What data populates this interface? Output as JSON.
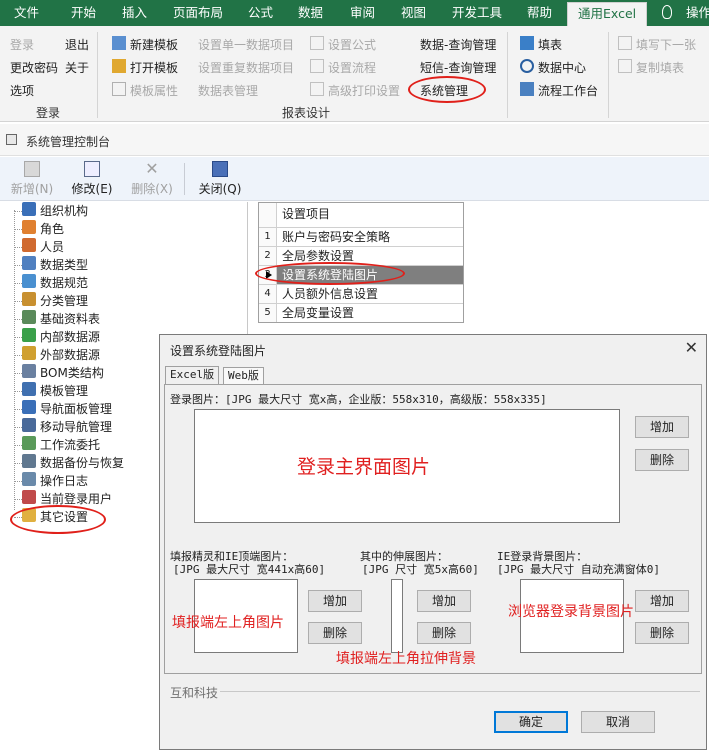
{
  "ribbon": {
    "tabs": [
      "文件",
      "开始",
      "插入",
      "页面布局",
      "公式",
      "数据",
      "审阅",
      "视图",
      "开发工具",
      "帮助",
      "通用Excel",
      "操作"
    ],
    "groups": {
      "login": {
        "label": "登录",
        "items": [
          "登录",
          "退出",
          "更改密码",
          "关于",
          "选项"
        ]
      },
      "report": {
        "label": "报表设计",
        "items": [
          "新建模板",
          "打开模板",
          "模板属性",
          "设置单一数据项目",
          "设置重复数据项目",
          "数据表管理",
          "设置公式",
          "设置流程",
          "高级打印设置",
          "数据-查询管理",
          "短信-查询管理",
          "系统管理"
        ]
      },
      "fill": {
        "items": [
          "填表",
          "数据中心",
          "流程工作台",
          "填写下一张",
          "复制填表"
        ]
      }
    }
  },
  "window": {
    "title": "系统管理控制台",
    "toolbar": [
      "新增(N)",
      "修改(E)",
      "删除(X)",
      "关闭(Q)"
    ]
  },
  "tree": {
    "items": [
      "组织机构",
      "角色",
      "人员",
      "数据类型",
      "数据规范",
      "分类管理",
      "基础资料表",
      "内部数据源",
      "外部数据源",
      "BOM类结构",
      "模板管理",
      "导航面板管理",
      "移动导航管理",
      "工作流委托",
      "数据备份与恢复",
      "操作日志",
      "当前登录用户",
      "其它设置"
    ]
  },
  "grid": {
    "header": "设置项目",
    "rows": [
      {
        "num": "1",
        "text": "账户与密码安全策略"
      },
      {
        "num": "2",
        "text": "全局参数设置"
      },
      {
        "num": "3",
        "text": "设置系统登陆图片"
      },
      {
        "num": "4",
        "text": "人员额外信息设置"
      },
      {
        "num": "5",
        "text": "全局变量设置"
      }
    ]
  },
  "dialog": {
    "title": "设置系统登陆图片",
    "close": "✕",
    "tabs": [
      "Excel版",
      "Web版"
    ],
    "login_label": "登录图片：[JPG 最大尺寸 宽x高，企业版：558x310，高级版：558x335]",
    "login_overlay": "登录主界面图片",
    "add": "增加",
    "delete": "删除",
    "sec1_label1": "填报精灵和IE顶端图片：",
    "sec1_label2": "[JPG 最大尺寸 宽441x高60]",
    "sec1_overlay": "填报端左上角图片",
    "sec2_label1": "其中的伸展图片：",
    "sec2_label2": "[JPG 尺寸 宽5x高60]",
    "sec2_overlay": "填报端左上角拉伸背景",
    "sec3_label1": "IE登录背景图片：",
    "sec3_label2": "[JPG 最大尺寸 自动充满窗体0]",
    "sec3_overlay": "浏览器登录背景图片",
    "footer": "互和科技",
    "ok": "确定",
    "cancel": "取消"
  }
}
